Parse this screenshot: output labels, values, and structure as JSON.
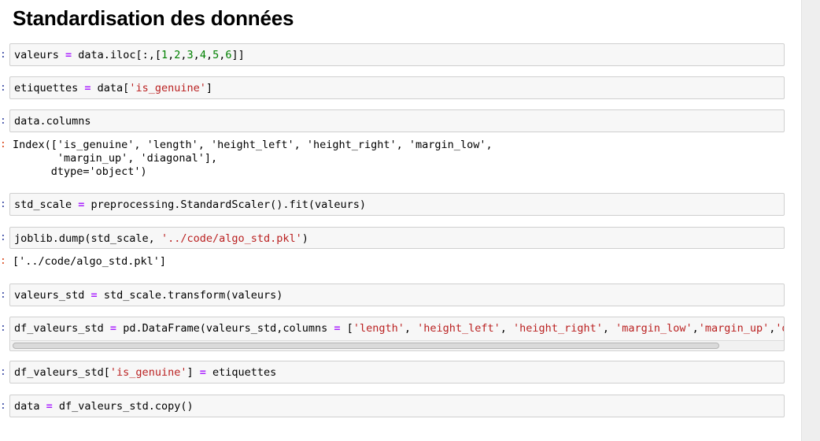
{
  "heading": "Standardisation des données",
  "prompt_in": ":",
  "prompt_out": ":",
  "cells": {
    "c1": {
      "a": "valeurs ",
      "op1": "=",
      "b": " data.iloc[:,[",
      "n1": "1",
      "s1": ",",
      "n2": "2",
      "s2": ",",
      "n3": "3",
      "s3": ",",
      "n4": "4",
      "s4": ",",
      "n5": "5",
      "s5": ",",
      "n6": "6",
      "c": "]]"
    },
    "c2": {
      "a": "etiquettes ",
      "op1": "=",
      "b": " data[",
      "str1": "'is_genuine'",
      "c": "]"
    },
    "c3": {
      "a": "data.columns"
    },
    "out3": "Index(['is_genuine', 'length', 'height_left', 'height_right', 'margin_low',\n       'margin_up', 'diagonal'],\n      dtype='object')",
    "c4": {
      "a": "std_scale ",
      "op1": "=",
      "b": " preprocessing.StandardScaler().fit(valeurs)"
    },
    "c5": {
      "a": "joblib.dump(std_scale, ",
      "str1": "'../code/algo_std.pkl'",
      "c": ")"
    },
    "out5": "['../code/algo_std.pkl']",
    "c6": {
      "a": "valeurs_std ",
      "op1": "=",
      "b": " std_scale.transform(valeurs)"
    },
    "c7": {
      "a": "df_valeurs_std ",
      "op1": "=",
      "b": " pd.DataFrame(valeurs_std,columns ",
      "op2": "=",
      "c": " [",
      "str1": "'length'",
      "d": ", ",
      "str2": "'height_left'",
      "e": ", ",
      "str3": "'height_right'",
      "f": ", ",
      "str4": "'margin_low'",
      "g": ",",
      "str5": "'margin_up'",
      "h": ",",
      "str6": "'dia"
    },
    "c8": {
      "a": "df_valeurs_std[",
      "str1": "'is_genuine'",
      "b": "] ",
      "op1": "=",
      "c": " etiquettes"
    },
    "c9": {
      "a": "data ",
      "op1": "=",
      "b": " df_valeurs_std.copy()"
    }
  },
  "colors": {
    "operator": "#aa22ff",
    "number": "#008000",
    "string": "#ba2121",
    "prompt_in": "#303f9f",
    "prompt_out": "#d84315"
  }
}
